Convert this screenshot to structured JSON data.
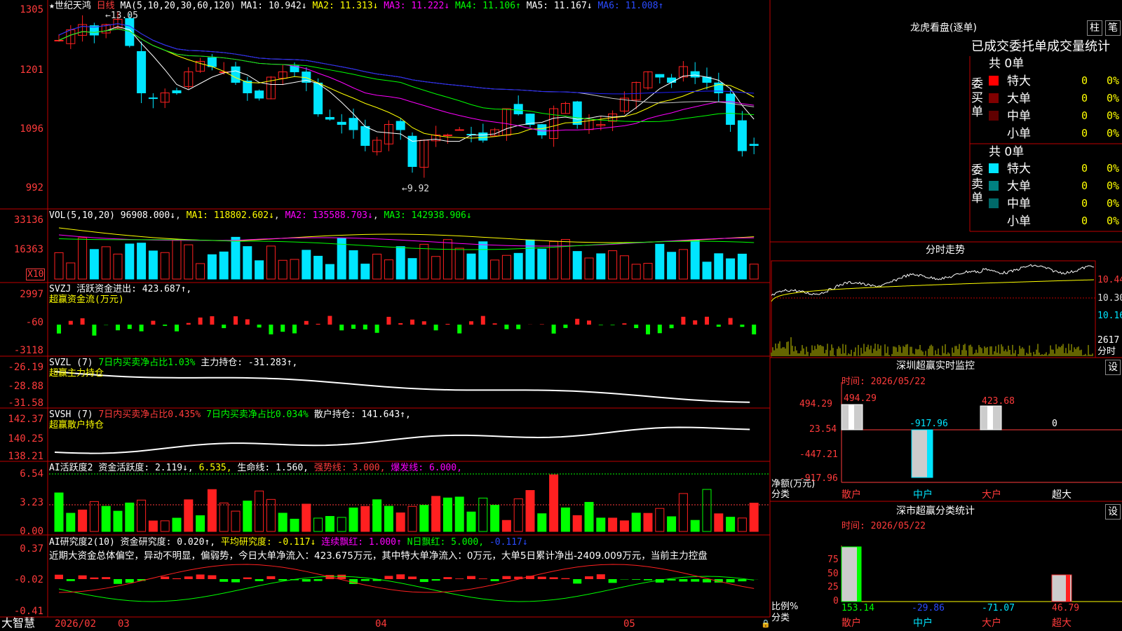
{
  "stock": {
    "name": "世纪天鸿",
    "period": "日线",
    "star": "★"
  },
  "colors": {
    "up": "#ff2020",
    "down": "#00e5ff",
    "frame": "#c00000",
    "ma1": "#ffffff",
    "ma2": "#ffff00",
    "ma3": "#ff00ff",
    "ma4": "#00ff00",
    "ma5": "#c8c8c8",
    "ma6": "#2020ff"
  },
  "main_legend": {
    "label": "MA(5,10,20,30,60,120)",
    "ma1": "MA1: 10.942↓",
    "ma2": "MA2: 11.313↓",
    "ma3": "MA3: 11.222↓",
    "ma4": "MA4: 11.106↑",
    "ma5": "MA5: 11.167↓",
    "ma6": "MA6: 11.008↑"
  },
  "main_axis": [
    "1305",
    "1201",
    "1096",
    "992"
  ],
  "price_marks": {
    "high": "13.05",
    "low": "9.92"
  },
  "vol_legend": {
    "label": "VOL(5,10,20)",
    "v": "96908.000↓",
    "ma1": "MA1: 118802.602↓",
    "ma2": "MA2: 135588.703↓",
    "ma3": "MA3: 142938.906↓"
  },
  "vol_axis": [
    "33136",
    "16363"
  ],
  "vol_unit": "X10",
  "svzj": {
    "label": "SVZJ",
    "text": "活跃资金进出: 423.687↑,",
    "sub": "超赢资金流(万元)",
    "axis": [
      "2997",
      "-60",
      "-3118"
    ]
  },
  "svzl": {
    "label": "SVZL (7)",
    "t1": "7日内买卖净占比1.03%",
    "t2": "主力持仓: -31.283↑,",
    "sub": "超赢主力持仓",
    "axis": [
      "-26.19",
      "-28.88",
      "-31.58"
    ]
  },
  "svsh": {
    "label": "SVSH (7)",
    "t1": "7日内买卖净占比0.435%",
    "t2": "7日内买卖净占比0.034%",
    "t3": "散户持仓: 141.643↑,",
    "sub": "超赢散户持仓",
    "axis": [
      "142.37",
      "140.25",
      "138.21"
    ]
  },
  "ai1": {
    "label": "AI活跃度2",
    "t1": "资金活跃度: 2.119↓,",
    "t2": "6.535,",
    "t3": "生命线: 1.560,",
    "t4": "强势线: 3.000,",
    "t5": "爆发线: 6.000,",
    "axis": [
      "6.54",
      "3.23",
      "0.00"
    ]
  },
  "ai2": {
    "label": "AI研究度2(10)",
    "t1": "资金研究度: 0.020↑,",
    "t2": "平均研究度: -0.117↓",
    "t3": "连续飘红: 1.000↑",
    "t4": "N日飘红: 5.000,",
    "t5": "-0.117↓",
    "text": "近期大资金总体偏空，异动不明显，偏弱势，今日大单净流入：423.675万元，其中特大单净流入：0万元，大单5日累计净出-2409.009万元，当前主力控盘",
    "axis": [
      "0.37",
      "-0.02",
      "-0.41"
    ]
  },
  "bottom": {
    "brand": "大智慧",
    "dates": [
      "2026/02",
      "03",
      "04",
      "05"
    ]
  },
  "right": {
    "lhb_title": "龙虎看盘(逐单)",
    "btn_zhu": "柱",
    "btn_bi": "笔",
    "stats_title": "已成交委托单成交量统计",
    "buy_label": "委买单",
    "sell_label": "委卖单",
    "buy_total": "共 0单",
    "sell_total": "共 0单",
    "rows": [
      "特大",
      "大单",
      "中单",
      "小单"
    ],
    "val": "0",
    "pct": "0%",
    "fenshi_title": "分时走势",
    "fenshi_axis": [
      "10.44",
      "10.30",
      "10.16"
    ],
    "fenshi_vol": "2617",
    "fenshi_unit": "分时",
    "sz_title": "深圳超赢实时监控",
    "sz_btn": "设",
    "sz_time": "时间: 2026/05/22",
    "sz_axis": [
      "494.29",
      "23.54",
      "-447.21",
      "-917.96"
    ],
    "sz_vals": [
      "494.29",
      "-917.96",
      "423.68",
      "0"
    ],
    "sz_ylabel": "净额(万元)",
    "sz_xlabel": "分类",
    "cats": [
      "散户",
      "中户",
      "大户",
      "超大"
    ],
    "fl_title": "深市超赢分类统计",
    "fl_btn": "设",
    "fl_time": "时间: 2026/05/22",
    "fl_axis": [
      "75",
      "50",
      "25",
      "0"
    ],
    "fl_vals": [
      "153.14",
      "-29.86",
      "-71.07",
      "46.79"
    ],
    "fl_ylabel": "比例%",
    "fl_xlabel": "分类"
  }
}
